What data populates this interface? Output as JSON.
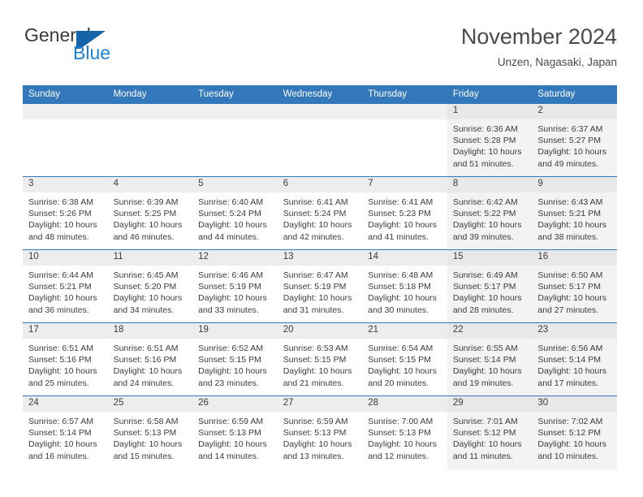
{
  "brand": {
    "name_part1": "General",
    "name_part2": "Blue"
  },
  "header": {
    "month_title": "November 2024",
    "location": "Unzen, Nagasaki, Japan"
  },
  "colors": {
    "header_blue": "#3478bc",
    "brand_blue": "#1b7fd4",
    "logo_mark": "#1464aa",
    "weekend_bg": "#f3f3f3",
    "daynum_bg": "#ededed",
    "text": "#3c3c3c"
  },
  "weekday_headers": [
    "Sunday",
    "Monday",
    "Tuesday",
    "Wednesday",
    "Thursday",
    "Friday",
    "Saturday"
  ],
  "weeks": [
    [
      {
        "day": "",
        "empty": true,
        "weekend": false,
        "sunrise": "",
        "sunset": "",
        "daylight_line1": "",
        "daylight_line2": ""
      },
      {
        "day": "",
        "empty": true,
        "weekend": false,
        "sunrise": "",
        "sunset": "",
        "daylight_line1": "",
        "daylight_line2": ""
      },
      {
        "day": "",
        "empty": true,
        "weekend": false,
        "sunrise": "",
        "sunset": "",
        "daylight_line1": "",
        "daylight_line2": ""
      },
      {
        "day": "",
        "empty": true,
        "weekend": false,
        "sunrise": "",
        "sunset": "",
        "daylight_line1": "",
        "daylight_line2": ""
      },
      {
        "day": "",
        "empty": true,
        "weekend": false,
        "sunrise": "",
        "sunset": "",
        "daylight_line1": "",
        "daylight_line2": ""
      },
      {
        "day": "1",
        "empty": false,
        "weekend": true,
        "sunrise": "Sunrise: 6:36 AM",
        "sunset": "Sunset: 5:28 PM",
        "daylight_line1": "Daylight: 10 hours",
        "daylight_line2": "and 51 minutes."
      },
      {
        "day": "2",
        "empty": false,
        "weekend": true,
        "sunrise": "Sunrise: 6:37 AM",
        "sunset": "Sunset: 5:27 PM",
        "daylight_line1": "Daylight: 10 hours",
        "daylight_line2": "and 49 minutes."
      }
    ],
    [
      {
        "day": "3",
        "empty": false,
        "weekend": false,
        "sunrise": "Sunrise: 6:38 AM",
        "sunset": "Sunset: 5:26 PM",
        "daylight_line1": "Daylight: 10 hours",
        "daylight_line2": "and 48 minutes."
      },
      {
        "day": "4",
        "empty": false,
        "weekend": false,
        "sunrise": "Sunrise: 6:39 AM",
        "sunset": "Sunset: 5:25 PM",
        "daylight_line1": "Daylight: 10 hours",
        "daylight_line2": "and 46 minutes."
      },
      {
        "day": "5",
        "empty": false,
        "weekend": false,
        "sunrise": "Sunrise: 6:40 AM",
        "sunset": "Sunset: 5:24 PM",
        "daylight_line1": "Daylight: 10 hours",
        "daylight_line2": "and 44 minutes."
      },
      {
        "day": "6",
        "empty": false,
        "weekend": false,
        "sunrise": "Sunrise: 6:41 AM",
        "sunset": "Sunset: 5:24 PM",
        "daylight_line1": "Daylight: 10 hours",
        "daylight_line2": "and 42 minutes."
      },
      {
        "day": "7",
        "empty": false,
        "weekend": false,
        "sunrise": "Sunrise: 6:41 AM",
        "sunset": "Sunset: 5:23 PM",
        "daylight_line1": "Daylight: 10 hours",
        "daylight_line2": "and 41 minutes."
      },
      {
        "day": "8",
        "empty": false,
        "weekend": true,
        "sunrise": "Sunrise: 6:42 AM",
        "sunset": "Sunset: 5:22 PM",
        "daylight_line1": "Daylight: 10 hours",
        "daylight_line2": "and 39 minutes."
      },
      {
        "day": "9",
        "empty": false,
        "weekend": true,
        "sunrise": "Sunrise: 6:43 AM",
        "sunset": "Sunset: 5:21 PM",
        "daylight_line1": "Daylight: 10 hours",
        "daylight_line2": "and 38 minutes."
      }
    ],
    [
      {
        "day": "10",
        "empty": false,
        "weekend": false,
        "sunrise": "Sunrise: 6:44 AM",
        "sunset": "Sunset: 5:21 PM",
        "daylight_line1": "Daylight: 10 hours",
        "daylight_line2": "and 36 minutes."
      },
      {
        "day": "11",
        "empty": false,
        "weekend": false,
        "sunrise": "Sunrise: 6:45 AM",
        "sunset": "Sunset: 5:20 PM",
        "daylight_line1": "Daylight: 10 hours",
        "daylight_line2": "and 34 minutes."
      },
      {
        "day": "12",
        "empty": false,
        "weekend": false,
        "sunrise": "Sunrise: 6:46 AM",
        "sunset": "Sunset: 5:19 PM",
        "daylight_line1": "Daylight: 10 hours",
        "daylight_line2": "and 33 minutes."
      },
      {
        "day": "13",
        "empty": false,
        "weekend": false,
        "sunrise": "Sunrise: 6:47 AM",
        "sunset": "Sunset: 5:19 PM",
        "daylight_line1": "Daylight: 10 hours",
        "daylight_line2": "and 31 minutes."
      },
      {
        "day": "14",
        "empty": false,
        "weekend": false,
        "sunrise": "Sunrise: 6:48 AM",
        "sunset": "Sunset: 5:18 PM",
        "daylight_line1": "Daylight: 10 hours",
        "daylight_line2": "and 30 minutes."
      },
      {
        "day": "15",
        "empty": false,
        "weekend": true,
        "sunrise": "Sunrise: 6:49 AM",
        "sunset": "Sunset: 5:17 PM",
        "daylight_line1": "Daylight: 10 hours",
        "daylight_line2": "and 28 minutes."
      },
      {
        "day": "16",
        "empty": false,
        "weekend": true,
        "sunrise": "Sunrise: 6:50 AM",
        "sunset": "Sunset: 5:17 PM",
        "daylight_line1": "Daylight: 10 hours",
        "daylight_line2": "and 27 minutes."
      }
    ],
    [
      {
        "day": "17",
        "empty": false,
        "weekend": false,
        "sunrise": "Sunrise: 6:51 AM",
        "sunset": "Sunset: 5:16 PM",
        "daylight_line1": "Daylight: 10 hours",
        "daylight_line2": "and 25 minutes."
      },
      {
        "day": "18",
        "empty": false,
        "weekend": false,
        "sunrise": "Sunrise: 6:51 AM",
        "sunset": "Sunset: 5:16 PM",
        "daylight_line1": "Daylight: 10 hours",
        "daylight_line2": "and 24 minutes."
      },
      {
        "day": "19",
        "empty": false,
        "weekend": false,
        "sunrise": "Sunrise: 6:52 AM",
        "sunset": "Sunset: 5:15 PM",
        "daylight_line1": "Daylight: 10 hours",
        "daylight_line2": "and 23 minutes."
      },
      {
        "day": "20",
        "empty": false,
        "weekend": false,
        "sunrise": "Sunrise: 6:53 AM",
        "sunset": "Sunset: 5:15 PM",
        "daylight_line1": "Daylight: 10 hours",
        "daylight_line2": "and 21 minutes."
      },
      {
        "day": "21",
        "empty": false,
        "weekend": false,
        "sunrise": "Sunrise: 6:54 AM",
        "sunset": "Sunset: 5:15 PM",
        "daylight_line1": "Daylight: 10 hours",
        "daylight_line2": "and 20 minutes."
      },
      {
        "day": "22",
        "empty": false,
        "weekend": true,
        "sunrise": "Sunrise: 6:55 AM",
        "sunset": "Sunset: 5:14 PM",
        "daylight_line1": "Daylight: 10 hours",
        "daylight_line2": "and 19 minutes."
      },
      {
        "day": "23",
        "empty": false,
        "weekend": true,
        "sunrise": "Sunrise: 6:56 AM",
        "sunset": "Sunset: 5:14 PM",
        "daylight_line1": "Daylight: 10 hours",
        "daylight_line2": "and 17 minutes."
      }
    ],
    [
      {
        "day": "24",
        "empty": false,
        "weekend": false,
        "sunrise": "Sunrise: 6:57 AM",
        "sunset": "Sunset: 5:14 PM",
        "daylight_line1": "Daylight: 10 hours",
        "daylight_line2": "and 16 minutes."
      },
      {
        "day": "25",
        "empty": false,
        "weekend": false,
        "sunrise": "Sunrise: 6:58 AM",
        "sunset": "Sunset: 5:13 PM",
        "daylight_line1": "Daylight: 10 hours",
        "daylight_line2": "and 15 minutes."
      },
      {
        "day": "26",
        "empty": false,
        "weekend": false,
        "sunrise": "Sunrise: 6:59 AM",
        "sunset": "Sunset: 5:13 PM",
        "daylight_line1": "Daylight: 10 hours",
        "daylight_line2": "and 14 minutes."
      },
      {
        "day": "27",
        "empty": false,
        "weekend": false,
        "sunrise": "Sunrise: 6:59 AM",
        "sunset": "Sunset: 5:13 PM",
        "daylight_line1": "Daylight: 10 hours",
        "daylight_line2": "and 13 minutes."
      },
      {
        "day": "28",
        "empty": false,
        "weekend": false,
        "sunrise": "Sunrise: 7:00 AM",
        "sunset": "Sunset: 5:13 PM",
        "daylight_line1": "Daylight: 10 hours",
        "daylight_line2": "and 12 minutes."
      },
      {
        "day": "29",
        "empty": false,
        "weekend": true,
        "sunrise": "Sunrise: 7:01 AM",
        "sunset": "Sunset: 5:12 PM",
        "daylight_line1": "Daylight: 10 hours",
        "daylight_line2": "and 11 minutes."
      },
      {
        "day": "30",
        "empty": false,
        "weekend": true,
        "sunrise": "Sunrise: 7:02 AM",
        "sunset": "Sunset: 5:12 PM",
        "daylight_line1": "Daylight: 10 hours",
        "daylight_line2": "and 10 minutes."
      }
    ]
  ]
}
